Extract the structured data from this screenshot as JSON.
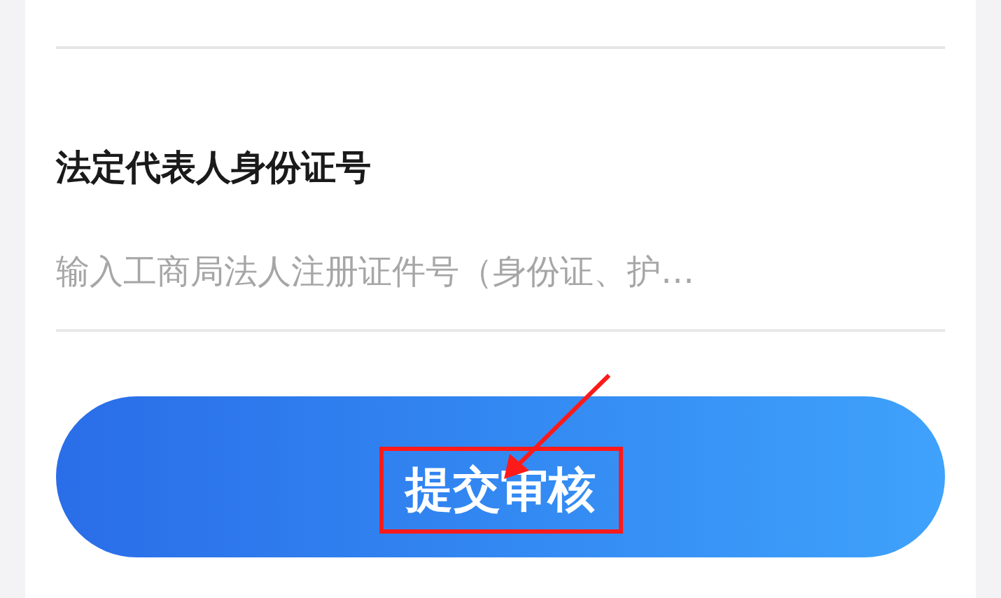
{
  "field": {
    "label": "法定代表人身份证号",
    "placeholder": "输入工商局法人注册证件号（身份证、护…"
  },
  "submit_button": {
    "label": "提交审核"
  }
}
